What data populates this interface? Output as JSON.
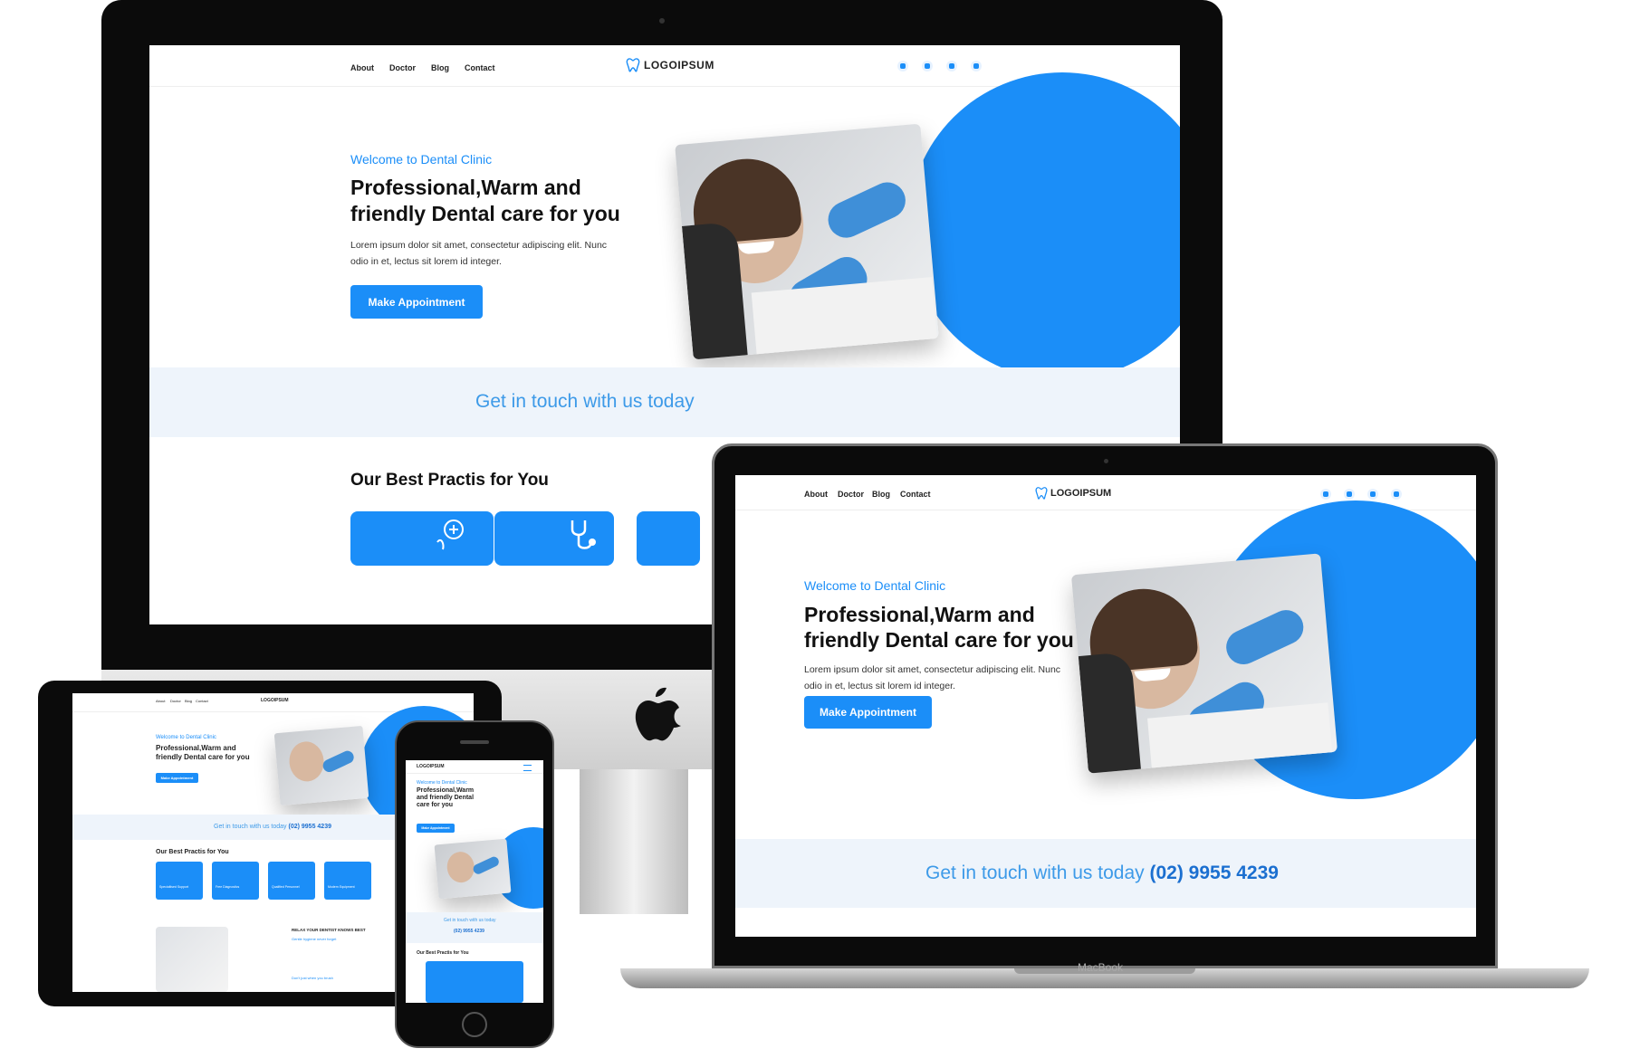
{
  "nav": {
    "about": "About",
    "doctor": "Doctor",
    "blog": "Blog",
    "contact": "Contact"
  },
  "brand": {
    "logo_text": "LOGOIPSUM",
    "logo_icon": "tooth-icon"
  },
  "social": [
    "instagram-icon",
    "facebook-icon",
    "twitter-icon",
    "youtube-icon"
  ],
  "hero": {
    "welcome": "Welcome to Dental Clinic",
    "headline_line1": "Professional,Warm and",
    "headline_line2": "friendly Dental care for you",
    "lead_line1": "Lorem ipsum dolor sit amet, consectetur adipiscing elit. Nunc",
    "lead_line2": "odio in et, lectus sit lorem id integer.",
    "cta": "Make Appointment"
  },
  "contact_strip": {
    "text": "Get in touch with us today",
    "phone": "(02) 9955 4239"
  },
  "practice": {
    "title": "Our Best Practis for You",
    "cards": [
      "Specialtised Support",
      "Free Diagnostics",
      "Qualified Personnel",
      "Modern Equipment"
    ]
  },
  "relax": {
    "heading": "RELAX YOUR DENTIST KNOWS BEST",
    "link1": "Gentle hygiene never forget",
    "link2": "Don't just when you brush"
  },
  "phone_view": {
    "headline_line1": "Professional,Warm",
    "headline_line2": "and friendly Dental",
    "headline_line3": "care for you",
    "touch_line": "Get in touch with us today"
  },
  "devices": {
    "laptop_label": "MacBook"
  },
  "colors": {
    "accent": "#1b8ef8",
    "strip": "#eef4fb",
    "frame": "#0d0d0d"
  }
}
